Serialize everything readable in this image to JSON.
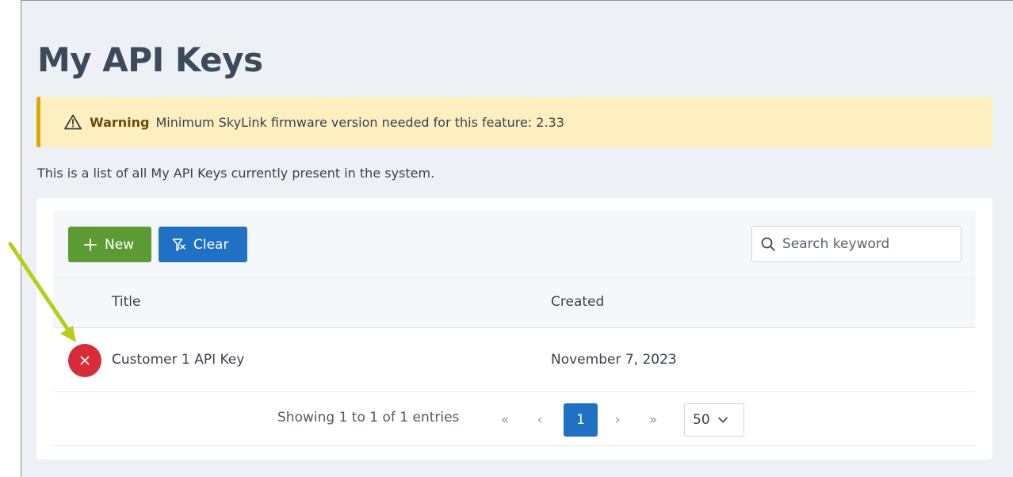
{
  "page": {
    "title": "My API Keys",
    "description": "This is a list of all My API Keys currently present in the system."
  },
  "warning": {
    "icon": "warning-triangle-icon",
    "label": "Warning",
    "message": "Minimum SkyLink firmware version needed for this feature: 2.33"
  },
  "toolbar": {
    "new_label": "New",
    "new_icon": "plus-icon",
    "clear_label": "Clear",
    "clear_icon": "filter-clear-icon",
    "search_placeholder": "Search keyword",
    "search_value": ""
  },
  "table": {
    "columns": [
      "Title",
      "Created"
    ],
    "rows": [
      {
        "title": "Customer 1 API Key",
        "created": "November 7, 2023"
      }
    ]
  },
  "pagination": {
    "info": "Showing 1 to 1 of 1 entries",
    "first": "«",
    "prev": "‹",
    "current_page": "1",
    "next": "›",
    "last": "»",
    "page_size": "50"
  },
  "colors": {
    "new_button": "#5c9b34",
    "clear_button": "#2071c4",
    "delete_button": "#d72d3a",
    "warning_bg": "#fdefbf",
    "warning_border": "#dba808",
    "annotation_arrow": "#b8cc1e"
  }
}
